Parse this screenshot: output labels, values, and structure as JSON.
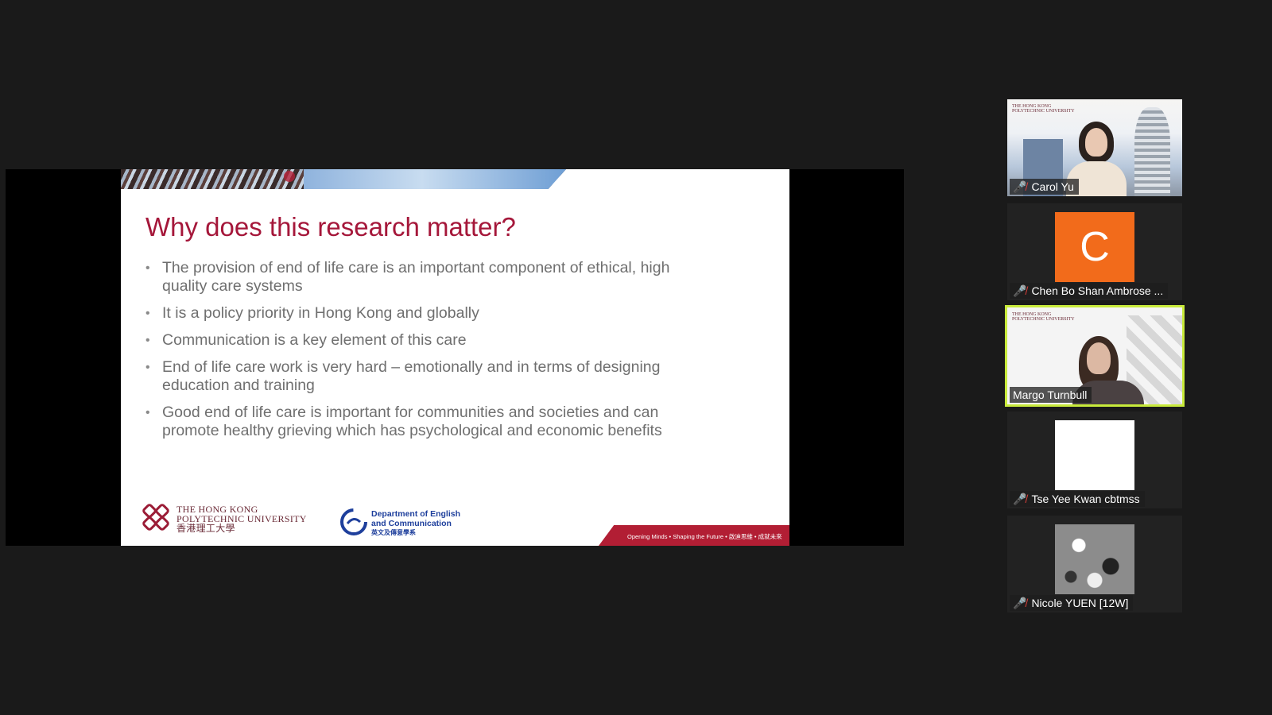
{
  "slide": {
    "title": "Why does this research matter?",
    "bullets": [
      "The provision of end of life care is an important component of ethical, high quality care systems",
      "It is a policy priority in Hong Kong and globally",
      "Communication is a key element of this care",
      "End of life care work is very hard – emotionally and in terms of designing education and training",
      "Good end of life care is important for communities and societies and can promote healthy grieving which has psychological and economic benefits"
    ],
    "bullet_glyph": "•",
    "university_logo": {
      "lines": [
        "The Hong Kong",
        "Polytechnic University",
        "香港理工大學"
      ]
    },
    "department_logo": {
      "lines": [
        "Department of English",
        "and Communication",
        "英文及傳意學系"
      ]
    },
    "tagline": "Opening Minds • Shaping the Future • 啟迪思維 • 成就未來",
    "colors": {
      "title": "#a5173a",
      "tagline_bg": "#b21e34",
      "dept_blue": "#1e3f9c"
    }
  },
  "participants": [
    {
      "name": "Carol Yu",
      "muted": true,
      "video": true,
      "active": false
    },
    {
      "name": "Chen Bo Shan Ambrose ...",
      "muted": true,
      "video": false,
      "avatar_letter": "C",
      "avatar_color": "#f26b1b",
      "active": false
    },
    {
      "name": "Margo Turnbull",
      "muted": false,
      "video": true,
      "active": true
    },
    {
      "name": "Tse Yee Kwan cbtmss",
      "muted": true,
      "video": false,
      "avatar_color": "#ffffff",
      "active": false
    },
    {
      "name": "Nicole YUEN [12W]",
      "muted": true,
      "video": false,
      "avatar_color": "#9a9a9a",
      "active": false
    }
  ],
  "icons": {
    "muted_mic": "mic-off-icon"
  },
  "active_speaker_color": "#c8ea3b"
}
